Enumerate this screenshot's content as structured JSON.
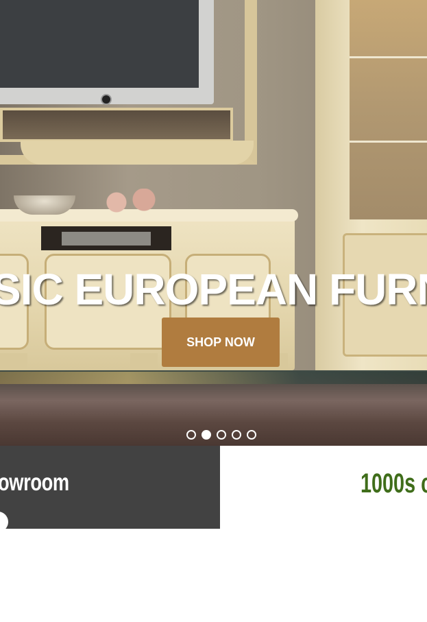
{
  "hero": {
    "title": "SIC EUROPEAN FURN",
    "cta_label": "SHOP NOW",
    "slides": [
      {
        "active": false
      },
      {
        "active": true
      },
      {
        "active": false
      },
      {
        "active": false
      },
      {
        "active": false
      }
    ]
  },
  "showroom": {
    "title": "owroom"
  },
  "highlight": {
    "heading": "1000s c"
  },
  "colors": {
    "cta": "#b07c3f",
    "dark_card": "#424242",
    "green_heading": "#3f6d1a"
  }
}
